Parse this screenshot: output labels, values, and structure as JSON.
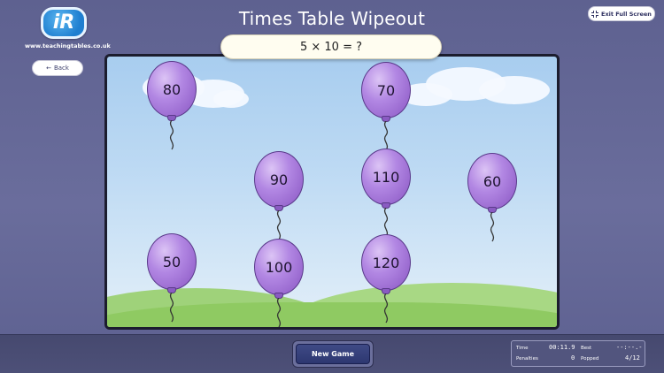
{
  "logo": {
    "badge": "iR",
    "url": "www.teachingtables.co.uk"
  },
  "header": {
    "title": "Times Table Wipeout",
    "back_label": "Back",
    "exit_label": "Exit Full Screen"
  },
  "question": {
    "text": "5 × 10 = ?"
  },
  "balloons": [
    {
      "value": "80"
    },
    {
      "value": "70"
    },
    {
      "value": "90"
    },
    {
      "value": "110"
    },
    {
      "value": "60"
    },
    {
      "value": "50"
    },
    {
      "value": "100"
    },
    {
      "value": "120"
    }
  ],
  "controls": {
    "new_game_label": "New Game"
  },
  "stats": {
    "time_label": "Time",
    "time_value": "00:11.9",
    "best_label": "Best",
    "best_value": "--:--.-",
    "penalties_label": "Penalties",
    "penalties_value": "0",
    "popped_label": "Popped",
    "popped_value": "4/12"
  },
  "colors": {
    "background": "#6a6d9c",
    "balloon": "#b287e3",
    "sky": "#bcd9f3",
    "grass": "#8fca62"
  }
}
